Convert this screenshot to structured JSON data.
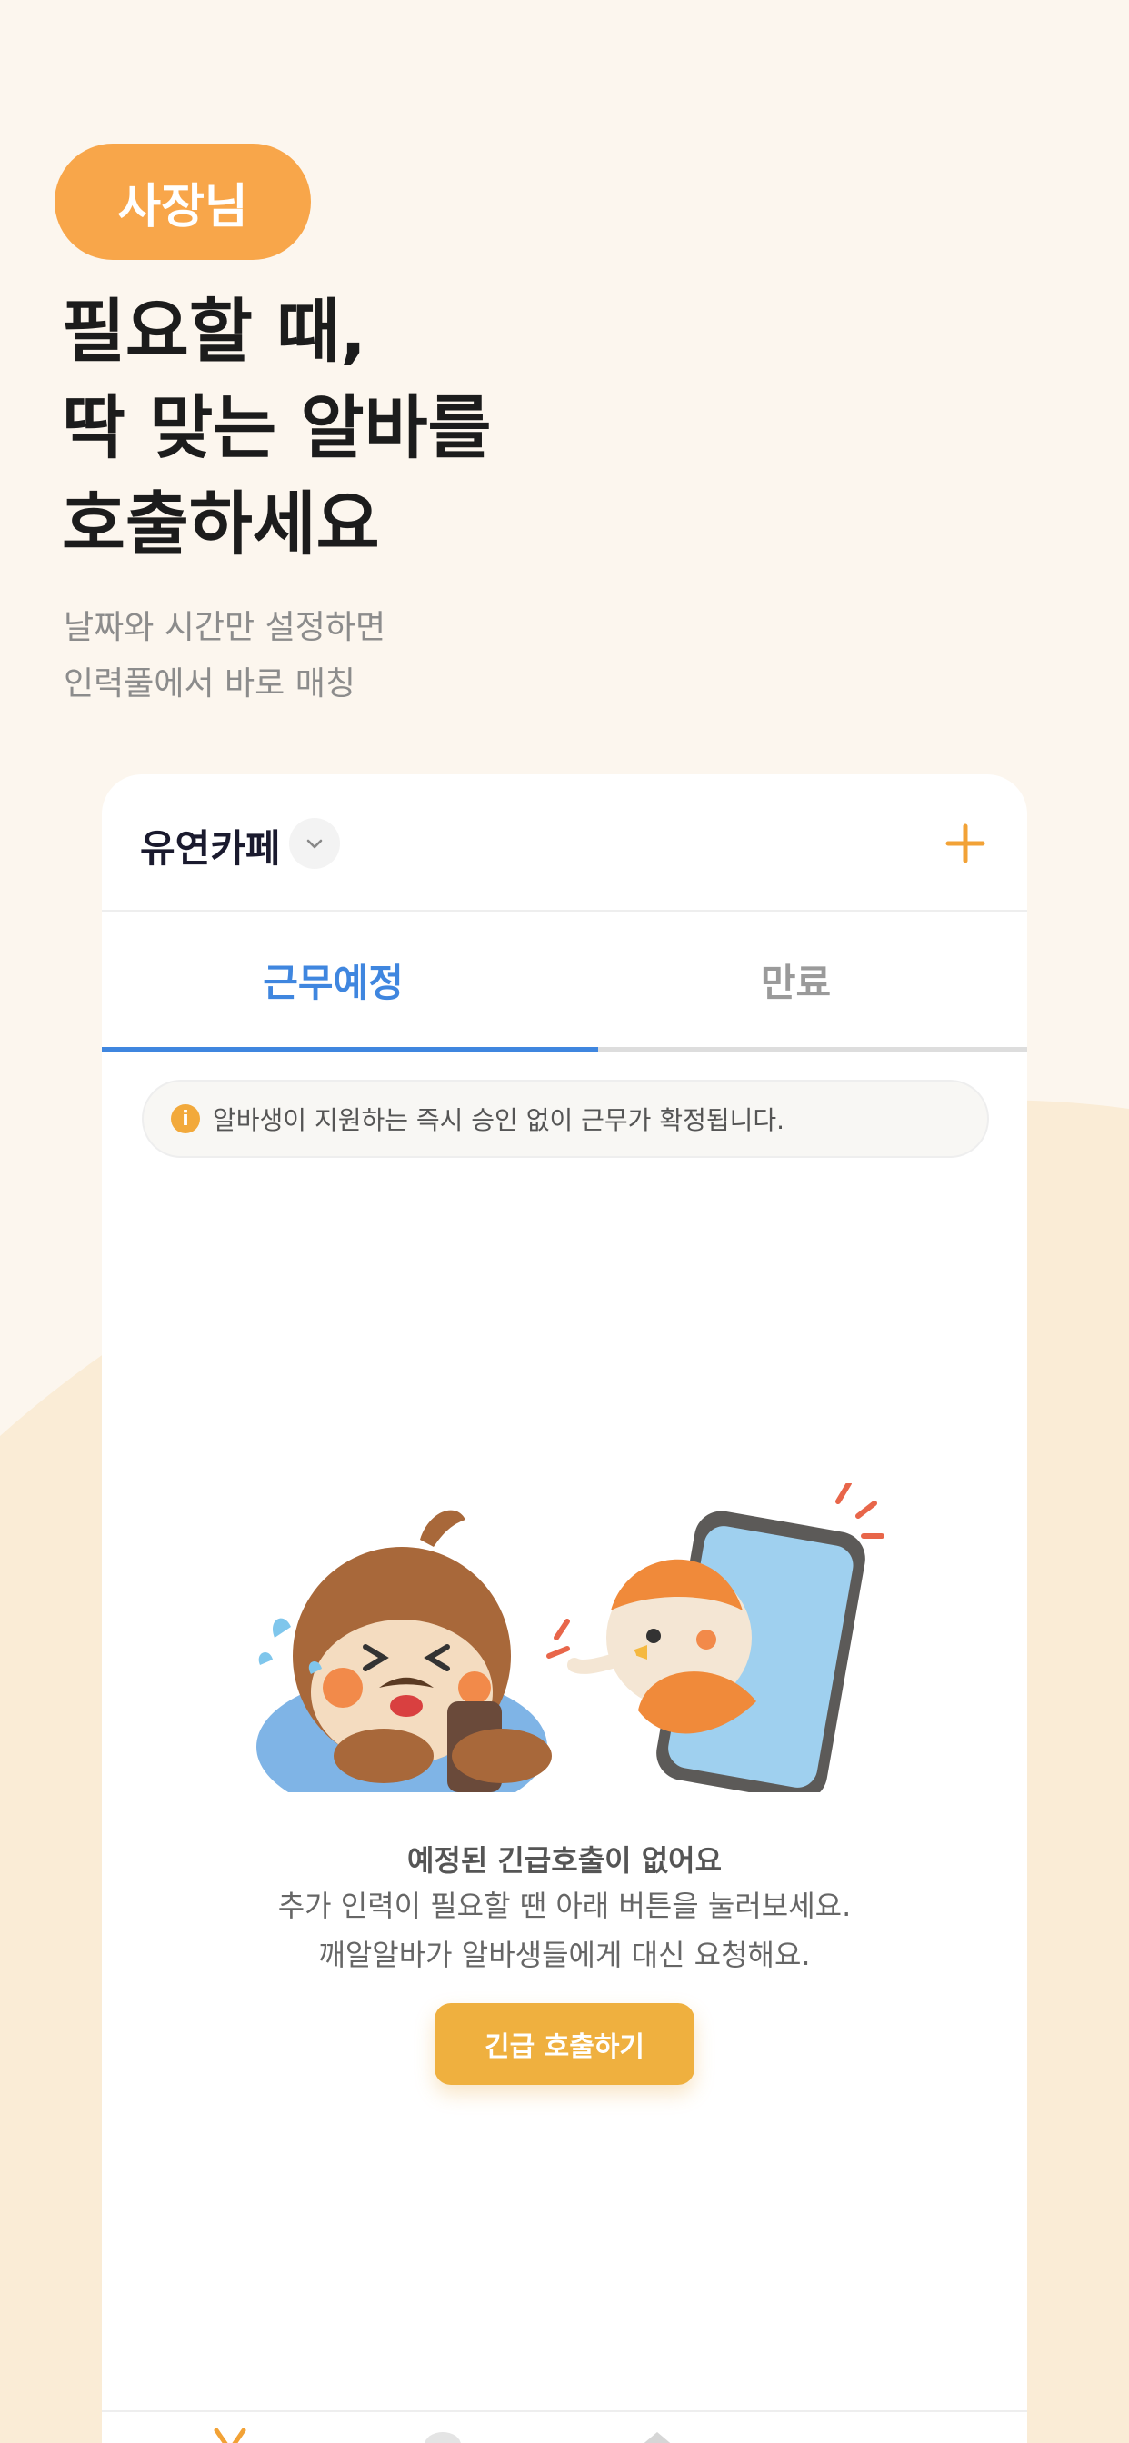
{
  "colors": {
    "background": "#fcf6ee",
    "accent_orange": "#f8a64a",
    "tab_active_blue": "#3f86df",
    "cta_orange": "#efb03f"
  },
  "badge": {
    "label": "사장님"
  },
  "headline": {
    "lines": [
      "필요할 때,",
      "딱 맞는 알바를",
      "호출하세요"
    ]
  },
  "subline": {
    "lines": [
      "날짜와 시간만 설정하면",
      "인력풀에서 바로 매칭"
    ]
  },
  "card": {
    "store_name": "유연카페",
    "dropdown_icon": "chevron-down-icon",
    "add_icon": "plus-icon",
    "tabs": [
      {
        "label": "근무예정",
        "active": true
      },
      {
        "label": "만료",
        "active": false
      }
    ],
    "notice": {
      "icon": "info-icon",
      "icon_glyph": "i",
      "text": "알바생이 지원하는 즉시 승인 없이 근무가 확정됩니다."
    },
    "empty_state": {
      "title": "예정된 긴급호출이 없어요",
      "desc_lines": [
        "추가 인력이 필요할 땐 아래 버튼을 눌러보세요.",
        "깨알알바가 알바생들에게 대신 요청해요."
      ],
      "cta_label": "긴급 호출하기"
    },
    "bottom_nav_icons": [
      "home-icon",
      "chat-icon",
      "profile-icon"
    ]
  }
}
